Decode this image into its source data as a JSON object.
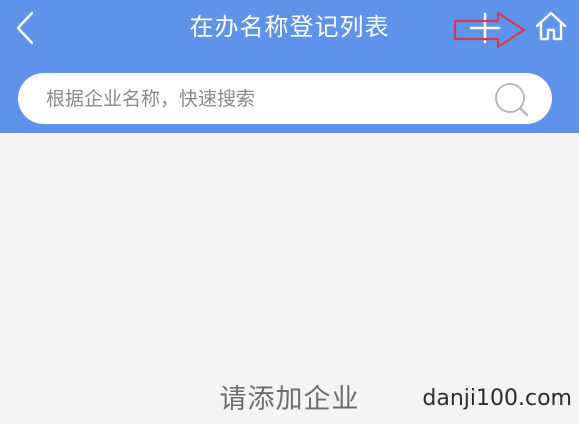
{
  "header": {
    "title": "在办名称登记列表",
    "background_color": "#5f92ea"
  },
  "nav": {
    "back_icon": "chevron-left-icon",
    "add_icon": "plus-icon",
    "home_icon": "home-icon"
  },
  "annotation": {
    "arrow_color": "#d23b54"
  },
  "search": {
    "placeholder": "根据企业名称，快速搜索",
    "value": "",
    "icon": "search-icon"
  },
  "empty_state": {
    "message": "请添加企业"
  },
  "watermark": {
    "text": "danji100.com"
  }
}
